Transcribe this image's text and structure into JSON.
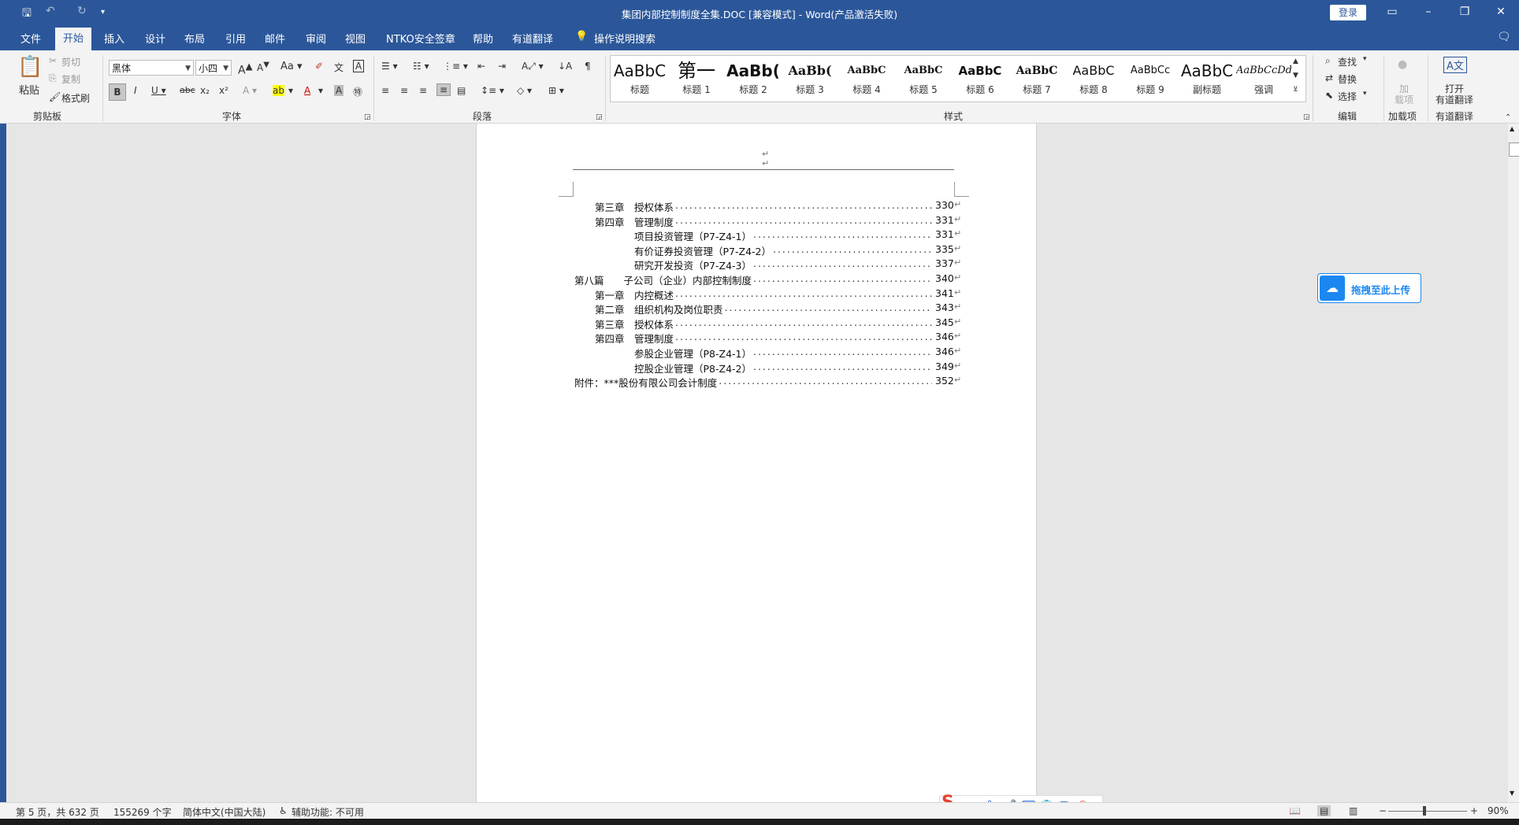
{
  "window": {
    "title": "集团内部控制制度全集.DOC [兼容模式]  -  Word(产品激活失败)",
    "login_label": "登录",
    "accent": "#2b579a"
  },
  "tabs": [
    {
      "label": "文件"
    },
    {
      "label": "开始"
    },
    {
      "label": "插入"
    },
    {
      "label": "设计"
    },
    {
      "label": "布局"
    },
    {
      "label": "引用"
    },
    {
      "label": "邮件"
    },
    {
      "label": "审阅"
    },
    {
      "label": "视图"
    },
    {
      "label": "NTKO安全签章"
    },
    {
      "label": "帮助"
    },
    {
      "label": "有道翻译"
    },
    {
      "label": "操作说明搜索"
    }
  ],
  "ribbon": {
    "clipboard": {
      "paste": "粘贴",
      "cut": "剪切",
      "copy": "复制",
      "format_painter": "格式刷",
      "group": "剪贴板"
    },
    "font": {
      "name": "黑体",
      "size": "小四",
      "group": "字体"
    },
    "paragraph": {
      "group": "段落"
    },
    "styles": {
      "group": "样式",
      "items": [
        {
          "preview": "AaBbC",
          "name": "标题"
        },
        {
          "preview": "第一",
          "name": "标题 1"
        },
        {
          "preview": "AaBb(",
          "name": "标题 2"
        },
        {
          "preview": "AaBb(",
          "name": "标题 3"
        },
        {
          "preview": "AaBbC",
          "name": "标题 4"
        },
        {
          "preview": "AaBbC",
          "name": "标题 5"
        },
        {
          "preview": "AaBbC",
          "name": "标题 6"
        },
        {
          "preview": "AaBbC",
          "name": "标题 7"
        },
        {
          "preview": "AaBbC",
          "name": "标题 8"
        },
        {
          "preview": "AaBbCc",
          "name": "标题 9"
        },
        {
          "preview": "AaBbC",
          "name": "副标题"
        },
        {
          "preview": "AaBbCcDd",
          "name": "强调"
        }
      ]
    },
    "editing": {
      "find": "查找",
      "replace": "替换",
      "select": "选择",
      "group": "编辑"
    },
    "addins": {
      "label1": "加",
      "label2": "载项",
      "group": "加载项"
    },
    "youdao": {
      "label1": "打开",
      "label2": "有道翻译",
      "group": "有道翻译"
    }
  },
  "document": {
    "toc": [
      {
        "indent": 1,
        "title": "第三章　授权体系",
        "page": "330"
      },
      {
        "indent": 1,
        "title": "第四章　管理制度",
        "page": "331"
      },
      {
        "indent": 2,
        "title": "项目投资管理（P7-Z4-1）",
        "page": "331"
      },
      {
        "indent": 2,
        "title": "有价证券投资管理（P7-Z4-2）",
        "page": "335"
      },
      {
        "indent": 2,
        "title": "研究开发投资（P7-Z4-3）",
        "page": "337"
      },
      {
        "indent": 0,
        "title": "第八篇　　子公司（企业）内部控制制度",
        "page": "340"
      },
      {
        "indent": 1,
        "title": "第一章　内控概述",
        "page": "341"
      },
      {
        "indent": 1,
        "title": "第二章　组织机构及岗位职责",
        "page": "343"
      },
      {
        "indent": 1,
        "title": "第三章　授权体系",
        "page": "345"
      },
      {
        "indent": 1,
        "title": "第四章　管理制度",
        "page": "346"
      },
      {
        "indent": 2,
        "title": "参股企业管理（P8-Z4-1）",
        "page": "346"
      },
      {
        "indent": 2,
        "title": "控股企业管理（P8-Z4-2）",
        "page": "349"
      },
      {
        "indent": 0,
        "title": "附件：***股份有限公司会计制度",
        "page": "352"
      }
    ]
  },
  "upload_widget": {
    "label": "拖拽至此上传"
  },
  "statusbar": {
    "page": "第 5 页，共 632 页",
    "words": "155269 个字",
    "language": "简体中文(中国大陆)",
    "accessibility": "辅助功能: 不可用",
    "zoom": "90%"
  },
  "ime": {
    "mode": "中"
  }
}
